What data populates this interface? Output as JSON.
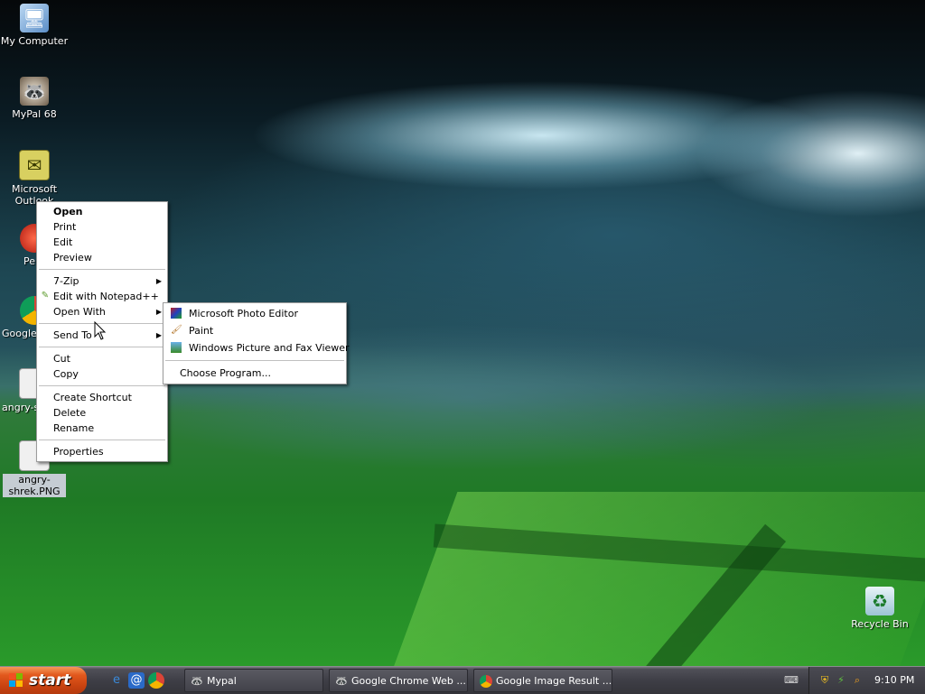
{
  "desktop": {
    "icons": [
      {
        "label": "My Computer"
      },
      {
        "label": "MyPal 68"
      },
      {
        "label": "Microsoft Outlook"
      },
      {
        "label": "Pe"
      },
      {
        "label": "Google C"
      },
      {
        "label": "angry-sh"
      },
      {
        "label": "angry-shrek.PNG"
      },
      {
        "label": "Recycle Bin"
      }
    ]
  },
  "context_menu": {
    "open": "Open",
    "print": "Print",
    "edit": "Edit",
    "preview": "Preview",
    "zip": "7-Zip",
    "notepadpp": "Edit with Notepad++",
    "open_with": "Open With",
    "send_to": "Send To",
    "cut": "Cut",
    "copy": "Copy",
    "create_shortcut": "Create Shortcut",
    "delete": "Delete",
    "rename": "Rename",
    "properties": "Properties"
  },
  "open_with_menu": {
    "items": [
      {
        "label": "Microsoft Photo Editor",
        "icon": "photo-editor-icon"
      },
      {
        "label": "Paint",
        "icon": "paint-icon"
      },
      {
        "label": "Windows Picture and Fax Viewer",
        "icon": "picture-viewer-icon"
      }
    ],
    "choose": "Choose Program..."
  },
  "taskbar": {
    "start_label": "start",
    "quick_launch": [
      "ie-icon",
      "mail-icon",
      "chrome-icon"
    ],
    "tasks": [
      {
        "label": "Mypal",
        "icon": "mypal-icon"
      },
      {
        "label": "Google Chrome Web ...",
        "icon": "mypal-icon"
      },
      {
        "label": "Google Image Result ...",
        "icon": "chrome-icon"
      }
    ],
    "clock": "9:10 PM"
  },
  "colors": {
    "start_button": "#e2581d",
    "taskbar": "#3e3e46",
    "menu_bg": "#ffffff"
  }
}
